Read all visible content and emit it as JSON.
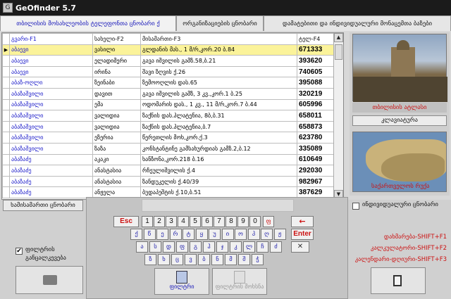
{
  "window": {
    "title": "GeOfinder 5.7",
    "icon_name": "app-icon"
  },
  "tabs": [
    {
      "label": "თბილისის მოსახლეობის ტელეფონთა ცნობარი ქ",
      "active": true
    },
    {
      "label": "ორგანიზაციების ცნობარი",
      "active": false
    },
    {
      "label": "დამატებითი და ინდივიდუალური მონაცემთა ბაზები",
      "active": false
    }
  ],
  "grid": {
    "columns": [
      "გვარი-F1",
      "სახელი-F2",
      "მისამართი-F3",
      "ტელ-F4"
    ],
    "selected_row": 0,
    "rows": [
      [
        "აბაევი",
        "ვასილი",
        "გლდანის მას., 1 მ/რ,კორ.20    ბ.84",
        "671333"
      ],
      [
        "აბაევი",
        "ელადიმერი",
        "გავა იშვილის გამზ.58,ბ.21",
        "393620"
      ],
      [
        "აბაევი",
        "ირინა",
        "შავი ზღვის ქ.26",
        "740605"
      ],
      [
        "აბაზ-ოღლი",
        "ზეინაბი",
        "ზემოოღლის დას.65",
        "395088"
      ],
      [
        "აბაზაშვილი",
        "დავით",
        "გავა იშვილის გამზ, 3 კვ.,კორ.1    ბ.25",
        "320219"
      ],
      [
        "აბაზაშვილი",
        "ემა",
        "ოდომარის დას., 1 კვ., 11 მ/რ,კორ.7    ბ.44",
        "605996"
      ],
      [
        "აბაზაშვილი",
        "ვალიდია",
        "ზაქნის დას.პლატენია, 8ბ,ბ.31",
        "658011"
      ],
      [
        "აბაზაშვილი",
        "ვალიდია",
        "ზაქნის დას.პლატენია,ბ.7",
        "658873"
      ],
      [
        "აბაზაშვილი",
        "ეზერია",
        "წერეთლის მოხ,კორ.ქ.3",
        "623780"
      ],
      [
        "აბაზაშვილი",
        "ზაზა",
        "კონსტანტინე გამსახურდიას გამზ.2,ბ.12",
        "335089"
      ],
      [
        "აბაზაძე",
        "აკაკი",
        "ხანზონა,კორ.218    ბ.16",
        "610649"
      ],
      [
        "აბაზაძე",
        "ანასტასია",
        "რჩეულიშვილის ქ.4",
        "292030"
      ],
      [
        "აბაზაძე",
        "ანასტასია",
        "ზანდუკელის ქ.40/39",
        "982967"
      ],
      [
        "აბაზაძე",
        "ანჟელა",
        "ბუდაპეშტის ქ.10,ბ.51",
        "387629"
      ]
    ]
  },
  "right_panel": {
    "photo_caption": "თბილისის ატლასი",
    "keyboard_button": "კლავიატურა",
    "map_caption": "საქართველოს რუქა"
  },
  "search_button": "ხამისამართი ცნობარი",
  "filter_checkbox": {
    "label_line1": "ფილტრის",
    "label_line2": "განცალკევება",
    "checked": true
  },
  "individual_checkbox": {
    "label": "ინდივიდუალური ცნობარი",
    "checked": false
  },
  "keyboard": {
    "esc": "Esc",
    "enter": "Enter",
    "numbers": [
      "1",
      "2",
      "3",
      "4",
      "5",
      "6",
      "7",
      "8",
      "9",
      "0"
    ],
    "backspace": "←",
    "extra_key": "ფ",
    "row2": [
      "ქ",
      "წ",
      "ე",
      "რ",
      "ტ",
      "ყ",
      "უ",
      "ი",
      "ო",
      "პ",
      "ღ",
      "ჟ"
    ],
    "row3": [
      "ა",
      "ს",
      "დ",
      "ფ",
      "გ",
      "ჰ",
      "ჯ",
      "კ",
      "ლ",
      "ჩ",
      "ძ"
    ],
    "row4": [
      "ზ",
      "ხ",
      "ც",
      "ვ",
      "ბ",
      "ნ",
      "მ",
      "შ",
      "ჭ"
    ]
  },
  "buttons": {
    "filter": "ფილტრი",
    "filter_clear": "ფილტრის მოხსნა"
  },
  "hotkeys": [
    "დახმარება-SHIFT+F1",
    "კალკულატორი-SHIFT+F2",
    "კალენდარი-დღიური-SHIFT+F3"
  ]
}
